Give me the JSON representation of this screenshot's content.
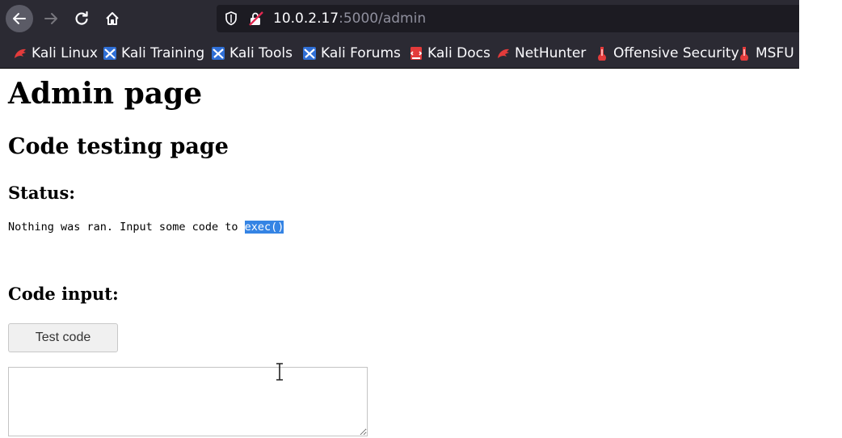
{
  "browser": {
    "url_host": "10.0.2.17",
    "url_rest": ":5000/admin",
    "bookmarks": [
      {
        "label": "Kali Linux",
        "icon": "kali-dragon-icon"
      },
      {
        "label": "Kali Training",
        "icon": "kali-tools-icon"
      },
      {
        "label": "Kali Tools",
        "icon": "kali-tools-icon"
      },
      {
        "label": "Kali Forums",
        "icon": "kali-tools-icon"
      },
      {
        "label": "Kali Docs",
        "icon": "kali-docs-icon"
      },
      {
        "label": "NetHunter",
        "icon": "kali-dragon-icon"
      },
      {
        "label": "Offensive Security",
        "icon": "offsec-icon"
      },
      {
        "label": "MSFU",
        "icon": "offsec-icon"
      }
    ]
  },
  "page": {
    "title": "Admin page",
    "subtitle": "Code testing page",
    "status_heading": "Status:",
    "status_text": "Nothing was ran. Input some code to ",
    "status_highlight": "exec()",
    "input_heading": "Code input:",
    "test_button_label": "Test code",
    "code_value": ""
  },
  "colors": {
    "toolbar_bg": "#2b2a33",
    "selection": "#3584e4"
  }
}
